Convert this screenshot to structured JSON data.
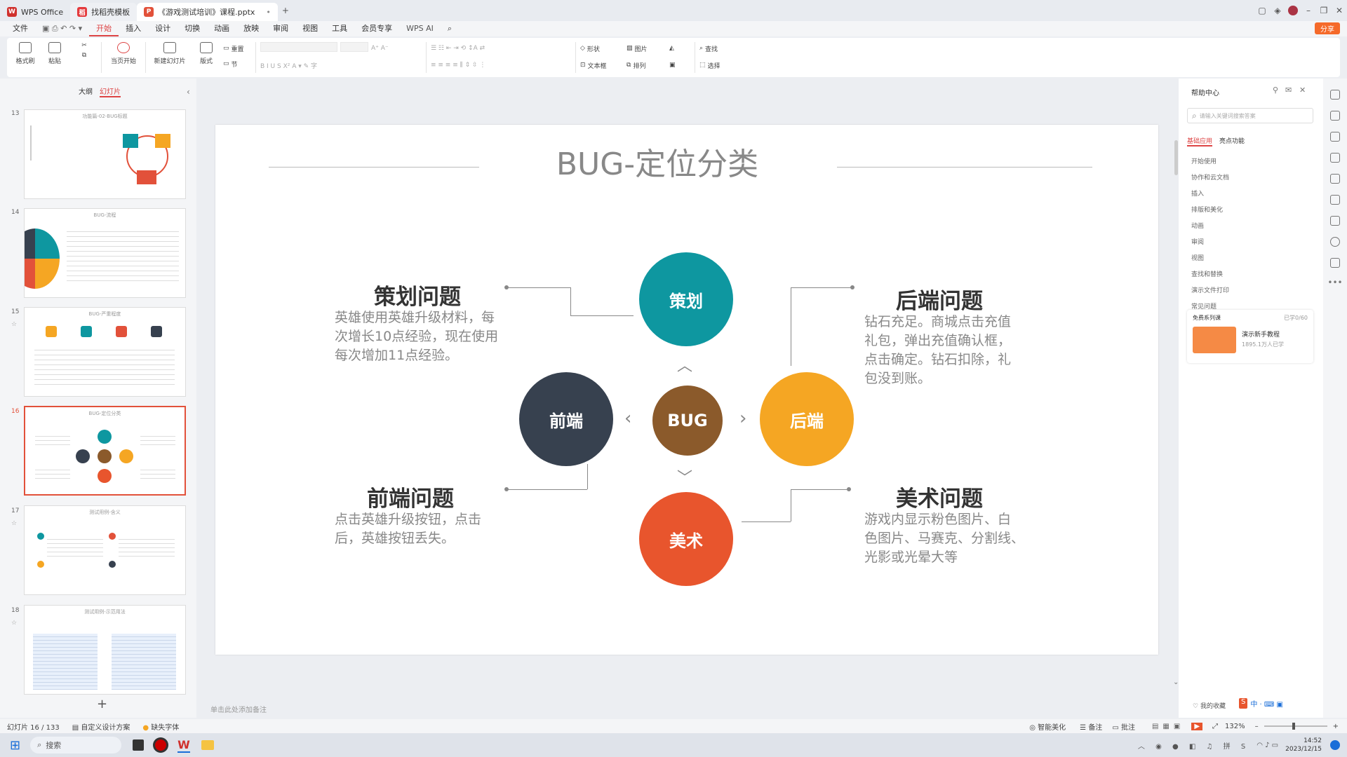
{
  "titlebar": {
    "tabs": [
      {
        "label": "WPS Office",
        "color": "#d0312d",
        "glyph": "W"
      },
      {
        "label": "找稻壳模板",
        "color": "#e4393c",
        "glyph": "稻"
      },
      {
        "label": "《游戏测试培训》课程.pptx",
        "color": "#e2513a",
        "glyph": "P"
      }
    ]
  },
  "menubar": {
    "file": "文件",
    "items": [
      "开始",
      "插入",
      "设计",
      "切换",
      "动画",
      "放映",
      "审阅",
      "视图",
      "工具",
      "会员专享"
    ],
    "ai": "WPS AI",
    "share": "分享"
  },
  "ribbon": {
    "format_painter": "格式刷",
    "paste": "粘贴",
    "from_current": "当页开始",
    "new_slide": "新建幻灯片",
    "layout": "版式",
    "section": "节",
    "reset": "重置",
    "shape": "形状",
    "picture": "图片",
    "textbox": "文本框",
    "arrange": "排列",
    "find": "查找",
    "select": "选择"
  },
  "left_panel": {
    "tab_outline": "大纲",
    "tab_slides": "幻灯片",
    "thumbs": [
      {
        "num": "13",
        "title": "功能篇-02-BUG标题"
      },
      {
        "num": "14",
        "title": "BUG-流程"
      },
      {
        "num": "15",
        "title": "BUG-严重程度"
      },
      {
        "num": "16",
        "title": "BUG-定位分类"
      },
      {
        "num": "17",
        "title": "测试用例-含义"
      },
      {
        "num": "18",
        "title": "测试用例-示范用法"
      }
    ],
    "add": "+"
  },
  "slide": {
    "title": "BUG-定位分类",
    "center": "BUG",
    "top": "策划",
    "left": "前端",
    "right": "后端",
    "bottom": "美术",
    "q1_title": "策划问题",
    "q1_desc": [
      "英雄使用英雄升级材料，每",
      "次增长10点经验，现在使用",
      "每次增加11点经验。"
    ],
    "q2_title": "后端问题",
    "q2_desc": [
      "钻石充足。商城点击充值",
      "礼包，弹出充值确认框，",
      "点击确定。钻石扣除，礼",
      "包没到账。"
    ],
    "q3_title": "前端问题",
    "q3_desc": [
      "点击英雄升级按钮，点击",
      "后，英雄按钮丢失。"
    ],
    "q4_title": "美术问题",
    "q4_desc": [
      "游戏内显示粉色图片、白",
      "色图片、马赛克、分割线、",
      "光影或光晕大等"
    ],
    "colors": {
      "top": "#0e97a0",
      "left": "#37414f",
      "right": "#f5a623",
      "bottom": "#e8552d",
      "center": "#8b5a2b"
    }
  },
  "notes_placeholder": "单击此处添加备注",
  "right_panel": {
    "title": "帮助中心",
    "search_placeholder": "请输入关键词搜索答案",
    "tab_basic": "基础应用",
    "tab_special": "亮点功能",
    "items": [
      "开始使用",
      "协作和云文档",
      "插入",
      "排版和美化",
      "动画",
      "审阅",
      "视图",
      "查找和替换",
      "演示文件打印",
      "常见问题"
    ],
    "course_title": "免费系列课",
    "course_progress": "已学0/60",
    "course_name": "演示新手教程",
    "course_count": "1895.1万人已学",
    "favorite": "我的收藏"
  },
  "statusbar": {
    "slide_info": "幻灯片 16 / 133",
    "design": "自定义设计方案",
    "missing_font": "缺失字体",
    "beautify": "智能美化",
    "notes": "备注",
    "comment": "批注",
    "zoom": "132%"
  },
  "taskbar": {
    "search": "搜索",
    "time": "14:52",
    "date": "2023/12/15"
  }
}
